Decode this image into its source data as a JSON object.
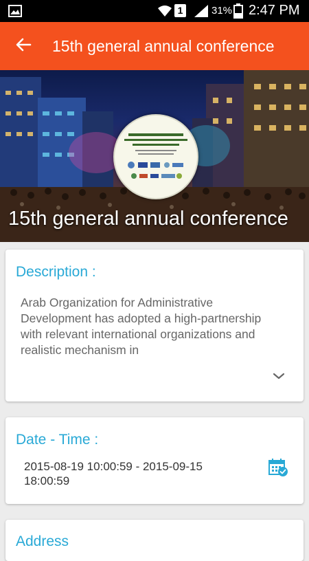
{
  "status_bar": {
    "battery_percent": "31%",
    "time": "2:47 PM",
    "sim_slot": "1",
    "icons": [
      "gallery-icon",
      "wifi-icon",
      "signal-icon",
      "battery-icon"
    ]
  },
  "app_bar": {
    "title": "15th general annual conference",
    "back_icon": "arrow-left-icon",
    "background_color": "#f4511e"
  },
  "hero": {
    "title": "15th general annual conference"
  },
  "description": {
    "heading": "Description :",
    "text": "Arab Organization for Administrative Development has adopted a high-partnership with relevant international organizations and realistic mechanism in",
    "expand_icon": "chevron-down-icon"
  },
  "date_time": {
    "heading": "Date - Time :",
    "value": "2015-08-19 10:00:59 - 2015-09-15 18:00:59",
    "action_icon": "calendar-check-icon"
  },
  "address": {
    "heading": "Address"
  },
  "colors": {
    "accent": "#29a9d6",
    "app_bar": "#f4511e",
    "background": "#ececec"
  }
}
